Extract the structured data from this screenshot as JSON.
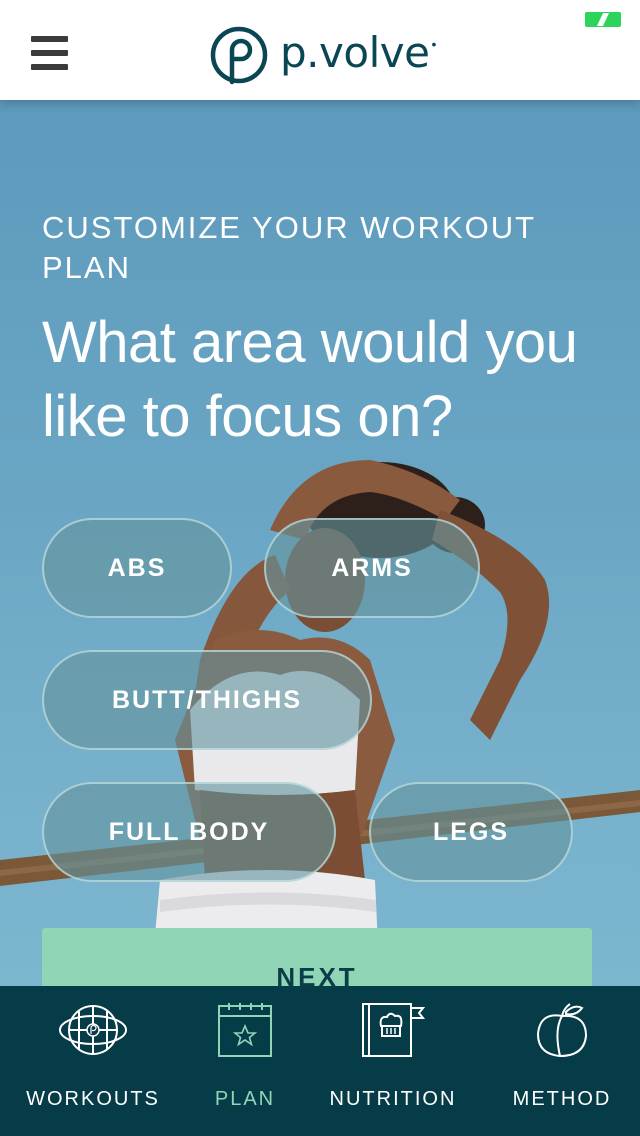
{
  "header": {
    "logo_text": "p.volve",
    "logo_dot": "•",
    "menu_icon": "hamburger-icon"
  },
  "hero": {
    "eyebrow": "CUSTOMIZE YOUR WORKOUT PLAN",
    "headline": "What area would you like to focus on?",
    "options": [
      {
        "label": "ABS"
      },
      {
        "label": "ARMS"
      },
      {
        "label": "BUTT/THIGHS"
      },
      {
        "label": "FULL BODY"
      },
      {
        "label": "LEGS"
      }
    ],
    "next_label": "NEXT"
  },
  "tabbar": {
    "active_tab": "PLAN",
    "tabs": [
      {
        "label": "WORKOUTS",
        "icon": "globe-logo-icon"
      },
      {
        "label": "PLAN",
        "icon": "calendar-star-icon"
      },
      {
        "label": "NUTRITION",
        "icon": "chef-book-icon"
      },
      {
        "label": "METHOD",
        "icon": "peach-icon"
      }
    ]
  },
  "colors": {
    "brand_dark": "#0b4654",
    "tabbar_bg": "#063b48",
    "accent_mint": "#8fd5b6",
    "battery": "#2bd45a"
  }
}
